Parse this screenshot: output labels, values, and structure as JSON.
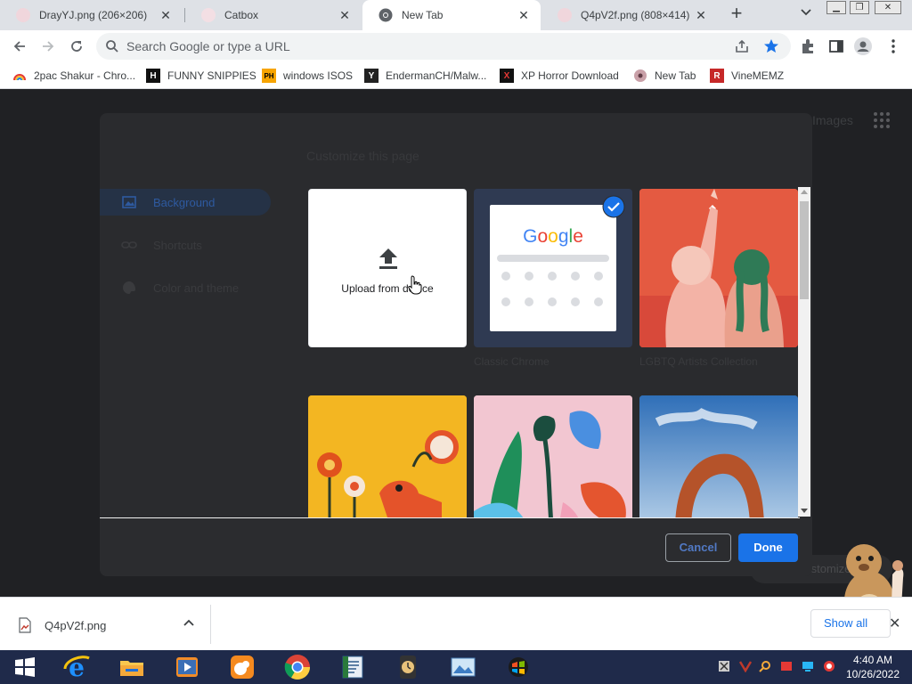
{
  "browser": {
    "tabs": [
      {
        "title": "DrayYJ.png (206×206)",
        "active": false
      },
      {
        "title": "Catbox",
        "active": false
      },
      {
        "title": "New Tab",
        "active": true
      },
      {
        "title": "Q4pV2f.png (808×414)",
        "active": false
      }
    ],
    "new_tab_label": "+",
    "omnibox": {
      "placeholder": "Search Google or type a URL",
      "value": ""
    },
    "bookmarks": [
      {
        "label": "2pac Shakur - Chro...",
        "icon": "rainbow-icon"
      },
      {
        "label": "FUNNY SNIPPIES",
        "icon": "H"
      },
      {
        "label": "windows ISOS",
        "icon": "PH"
      },
      {
        "label": "EndermanCH/Malw...",
        "icon": "Y"
      },
      {
        "label": "XP Horror Download",
        "icon": "X"
      },
      {
        "label": "New Tab",
        "icon": "disc-icon"
      },
      {
        "label": "VineMEMZ",
        "icon": "R"
      }
    ]
  },
  "page": {
    "images_link": "Images",
    "customize_button_behind": "Customize"
  },
  "dialog": {
    "title": "Customize this page",
    "sidebar": [
      {
        "label": "Background",
        "selected": true
      },
      {
        "label": "Shortcuts",
        "selected": false
      },
      {
        "label": "Color and theme",
        "selected": false
      }
    ],
    "upload_label": "Upload from device",
    "tiles": [
      {
        "label": "Classic Chrome",
        "selected": true
      },
      {
        "label": "LGBTQ Artists Collection",
        "selected": false
      }
    ],
    "google_logo": "Google",
    "cancel_label": "Cancel",
    "done_label": "Done"
  },
  "downloads": {
    "file_name": "Q4pV2f.png",
    "show_all_label": "Show all"
  },
  "taskbar": {
    "time": "4:40 AM",
    "date": "10/26/2022"
  },
  "colors": {
    "accent": "#1a73e8",
    "dialog_bg": "#2a2b2e",
    "taskbar": "#1f2a4a"
  }
}
